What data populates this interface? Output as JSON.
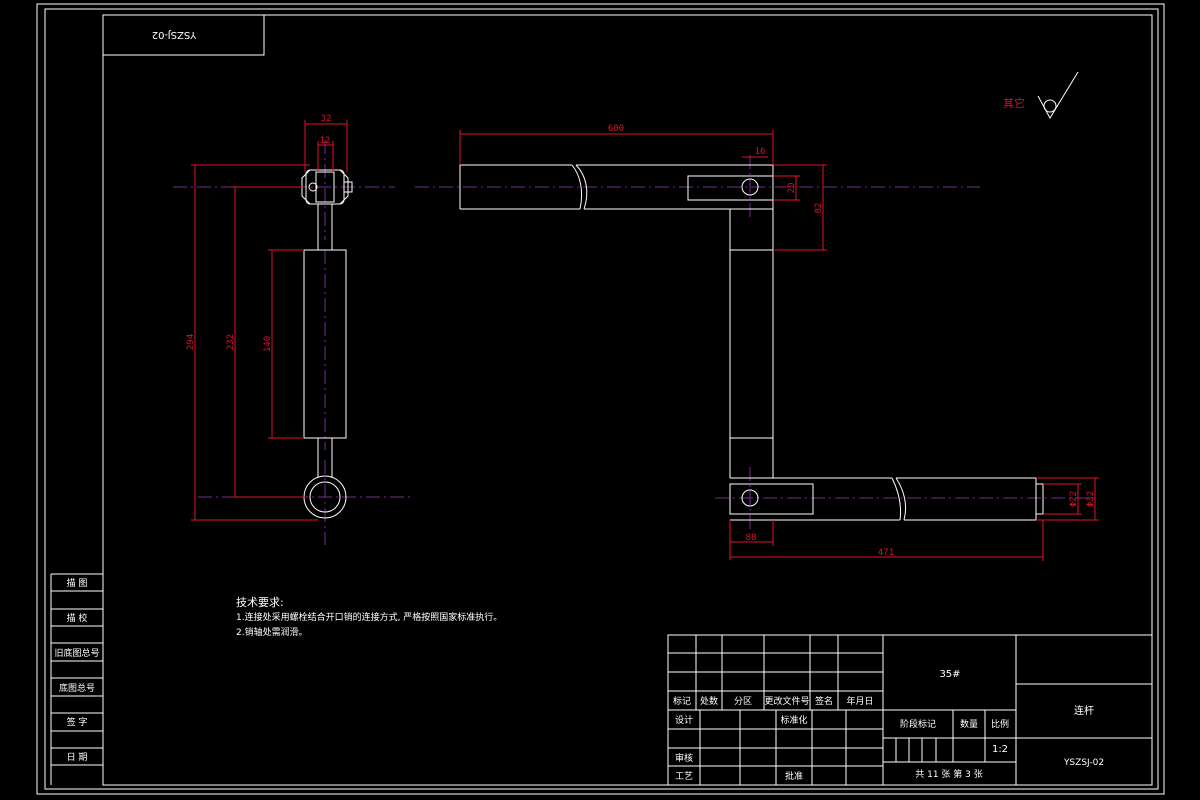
{
  "drawing": {
    "code_box": "YSZSJ-02",
    "roughness_label": "其它",
    "dims": {
      "d32": "32",
      "d12": "12",
      "d294": "294",
      "d232": "232",
      "d140": "140",
      "d600": "600",
      "d16": "16",
      "d20": "20",
      "d82": "82",
      "d88": "88",
      "d471": "471",
      "phi32": "Φ32",
      "phi22": "Φ22"
    }
  },
  "notes": {
    "title": "技术要求:",
    "line1": "1.连接处采用螺栓结合开口销的连接方式, 严格按照国家标准执行。",
    "line2": "2.销轴处需润滑。"
  },
  "side_column": [
    "描 图",
    "描 校",
    "旧底图总号",
    "底图总号",
    "签 字",
    "日 期"
  ],
  "title_block": {
    "material": "35#",
    "part_name": "连杆",
    "part_code": "YSZSJ-02",
    "scale": "1:2",
    "sheet_info": "共 11 张   第 3 张",
    "header_labels": [
      "标记",
      "处数",
      "分区",
      "更改文件号",
      "签名",
      "年月日"
    ],
    "design": "设计",
    "standard": "标准化",
    "review": "审核",
    "craft": "工艺",
    "approve": "批准",
    "stage_mark": "阶段标记",
    "quantity": "数量",
    "ratio": "比例"
  }
}
